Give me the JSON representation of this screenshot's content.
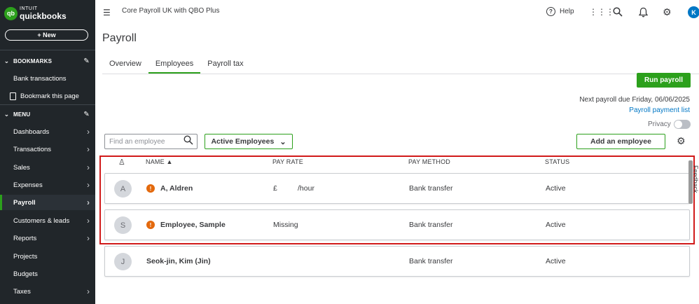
{
  "brand": {
    "logo_mark": "qb",
    "intuit": "INTUIT",
    "product": "quickbooks"
  },
  "sidebar": {
    "new_button": "+ New",
    "bookmarks_header": "BOOKMARKS",
    "bookmark_items": [
      "Bank transactions",
      "Bookmark this page"
    ],
    "menu_header": "MENU",
    "menu_items": [
      {
        "label": "Dashboards",
        "arrow": true
      },
      {
        "label": "Transactions",
        "arrow": true
      },
      {
        "label": "Sales",
        "arrow": true
      },
      {
        "label": "Expenses",
        "arrow": true
      },
      {
        "label": "Payroll",
        "arrow": true,
        "active": true
      },
      {
        "label": "Customers & leads",
        "arrow": true
      },
      {
        "label": "Reports",
        "arrow": true
      },
      {
        "label": "Projects",
        "arrow": false
      },
      {
        "label": "Budgets",
        "arrow": false
      },
      {
        "label": "Taxes",
        "arrow": true
      }
    ]
  },
  "topbar": {
    "company_name": "Core Payroll UK with QBO Plus",
    "help_label": "Help",
    "help_glyph": "?",
    "user_initial": "K",
    "icons": [
      "apps-grid-icon",
      "search-icon",
      "bell-icon",
      "gear-icon"
    ]
  },
  "page": {
    "title": "Payroll",
    "tabs": [
      {
        "label": "Overview",
        "active": false
      },
      {
        "label": "Employees",
        "active": true
      },
      {
        "label": "Payroll tax",
        "active": false
      }
    ],
    "run_payroll": "Run payroll",
    "next_payroll": "Next payroll due Friday, 06/06/2025",
    "payment_list_link": "Payroll payment list",
    "privacy_label": "Privacy",
    "search_placeholder": "Find an employee",
    "filter_label": "Active Employees",
    "add_employee": "Add an employee",
    "feedback": "Feedback"
  },
  "table": {
    "headers": {
      "name": "NAME ▲",
      "pay_rate": "PAY RATE",
      "pay_method": "PAY METHOD",
      "status": "STATUS"
    },
    "rows": [
      {
        "initial": "A",
        "name": "A, Aldren",
        "warning": true,
        "pay_rate": "£          /hour",
        "pay_method": "Bank transfer",
        "status": "Active"
      },
      {
        "initial": "S",
        "name": "Employee, Sample",
        "warning": true,
        "pay_rate": "Missing",
        "pay_method": "Bank transfer",
        "status": "Active"
      },
      {
        "initial": "J",
        "name": "Seok-jin, Kim (Jin)",
        "warning": false,
        "pay_rate": "",
        "pay_method": "Bank transfer",
        "status": "Active"
      }
    ]
  },
  "colors": {
    "brand_green": "#2ca01c",
    "sidebar_bg": "#21262a",
    "link_blue": "#0077c5",
    "warning_orange": "#e3690d",
    "highlight_red": "#d11a1a"
  }
}
